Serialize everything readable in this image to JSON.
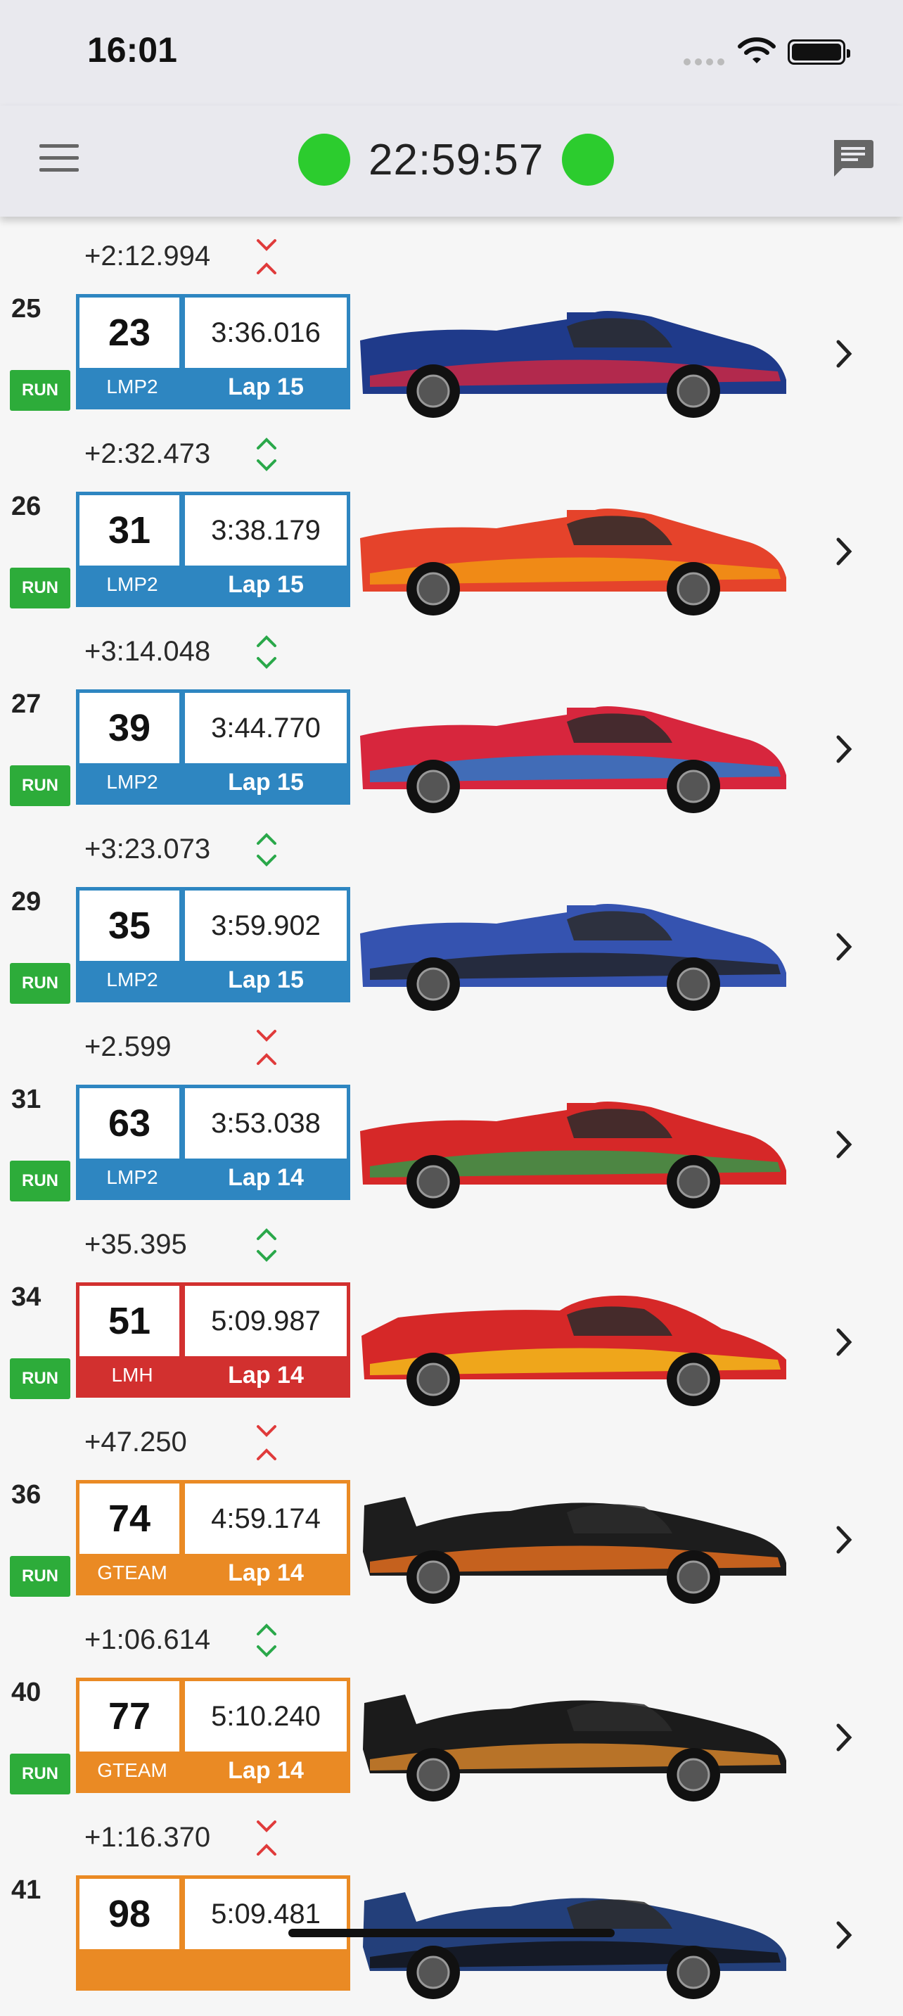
{
  "status_bar": {
    "time": "16:01"
  },
  "header": {
    "race_clock": "22:59:57",
    "flag_color": "#2ccc2e"
  },
  "class_colors": {
    "LMP2": "#2e86c1",
    "LMH": "#d2302f",
    "GTEAM": "#ea8a24"
  },
  "gaps": [
    {
      "text": "+2:12.994",
      "direction": "down"
    },
    {
      "text": "+2:32.473",
      "direction": "updown"
    },
    {
      "text": "+3:14.048",
      "direction": "updown"
    },
    {
      "text": "+3:23.073",
      "direction": "updown"
    },
    {
      "text": "+2.599",
      "direction": "down"
    },
    {
      "text": "+35.395",
      "direction": "updown"
    },
    {
      "text": "+47.250",
      "direction": "down"
    },
    {
      "text": "+1:06.614",
      "direction": "updown"
    },
    {
      "text": "+1:16.370",
      "direction": "down"
    }
  ],
  "entries": [
    {
      "position": "25",
      "status": "RUN",
      "number": "23",
      "last_lap": "3:36.016",
      "class": "LMP2",
      "lap": "Lap 15",
      "car": {
        "type": "proto",
        "body": "#1f3a8a",
        "accent": "#d7263d",
        "icon": "car-icon"
      }
    },
    {
      "position": "26",
      "status": "RUN",
      "number": "31",
      "last_lap": "3:38.179",
      "class": "LMP2",
      "lap": "Lap 15",
      "car": {
        "type": "proto",
        "body": "#e5432b",
        "accent": "#f39c12",
        "icon": "car-icon"
      }
    },
    {
      "position": "27",
      "status": "RUN",
      "number": "39",
      "last_lap": "3:44.770",
      "class": "LMP2",
      "lap": "Lap 15",
      "car": {
        "type": "proto",
        "body": "#d7263d",
        "accent": "#1c7ed6",
        "icon": "car-icon"
      }
    },
    {
      "position": "29",
      "status": "RUN",
      "number": "35",
      "last_lap": "3:59.902",
      "class": "LMP2",
      "lap": "Lap 15",
      "car": {
        "type": "proto",
        "body": "#3553b0",
        "accent": "#222222",
        "icon": "car-icon"
      }
    },
    {
      "position": "31",
      "status": "RUN",
      "number": "63",
      "last_lap": "3:53.038",
      "class": "LMP2",
      "lap": "Lap 14",
      "car": {
        "type": "proto",
        "body": "#d62828",
        "accent": "#2a9d4a",
        "icon": "car-icon"
      }
    },
    {
      "position": "34",
      "status": "RUN",
      "number": "51",
      "last_lap": "5:09.987",
      "class": "LMH",
      "lap": "Lap 14",
      "car": {
        "type": "hyper",
        "body": "#d62828",
        "accent": "#f5c518",
        "icon": "car-icon"
      }
    },
    {
      "position": "36",
      "status": "RUN",
      "number": "74",
      "last_lap": "4:59.174",
      "class": "GTEAM",
      "lap": "Lap 14",
      "car": {
        "type": "gt",
        "body": "#1d1d1d",
        "accent": "#f0731f",
        "icon": "car-icon"
      }
    },
    {
      "position": "40",
      "status": "RUN",
      "number": "77",
      "last_lap": "5:10.240",
      "class": "GTEAM",
      "lap": "Lap 14",
      "car": {
        "type": "gt",
        "body": "#1b1b1b",
        "accent": "#e08a2c",
        "icon": "car-icon"
      }
    },
    {
      "position": "41",
      "status": "",
      "number": "98",
      "last_lap": "5:09.481",
      "class": "",
      "lap": "",
      "car": {
        "type": "gt",
        "body": "#233f7a",
        "accent": "#111111",
        "icon": "car-icon"
      }
    }
  ]
}
